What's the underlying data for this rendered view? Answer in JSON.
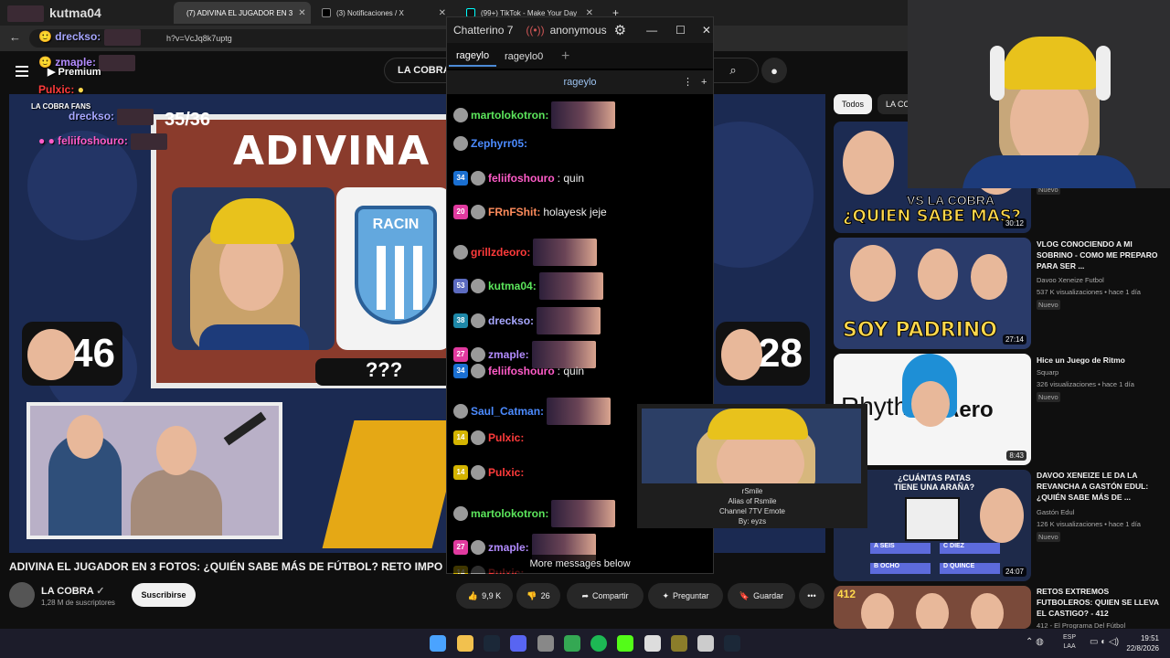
{
  "browser": {
    "tabs": [
      {
        "label": "(7) ADIVINA EL JUGADOR EN 3",
        "active": true
      },
      {
        "label": "(3) Notificaciones / X",
        "active": false
      },
      {
        "label": "(99+) TikTok - Make Your Day",
        "active": false
      }
    ],
    "first_tab_name": "kutma04",
    "url": "h?v=VcJq8k7uptg"
  },
  "youtube": {
    "search_text": "LA COBRA",
    "video": {
      "counter": "35/36",
      "thumbnail_title": "ADIVINA EL J",
      "logo_text": "RACIN",
      "left_score": "46",
      "right_score": "28",
      "question": "???"
    },
    "video_title": "ADIVINA EL JUGADOR EN 3 FOTOS: ¿QUIÉN SABE MÁS DE FÚTBOL? RETO IMPO",
    "channel": {
      "name": "LA COBRA",
      "subscribers": "1,28 M de suscriptores",
      "subscribe_label": "Suscribirse"
    },
    "actions": {
      "likes": "9,9 K",
      "dislikes": "26",
      "share": "Compartir",
      "ask": "Preguntar",
      "save": "Guardar"
    },
    "chips": [
      "Todos",
      "LA CO"
    ],
    "recommendations": [
      {
        "thumb_text": "¿QUIEN SABE MAS?",
        "thumb_sub": "VS LA COBRA",
        "duration": "30:12",
        "title": "",
        "channel": "",
        "meta": "",
        "badge": "Nuevo"
      },
      {
        "thumb_text": "SOY PADRINO",
        "thumb_sub": "",
        "duration": "27:14",
        "title": "VLOG CONOCIENDO A MI SOBRINO - COMO ME PREPARO PARA SER ...",
        "channel": "Davoo Xeneize Futbol",
        "meta": "537 K visualizaciones • hace 1 día",
        "badge": "Nuevo"
      },
      {
        "thumb_text": "Aero",
        "thumb_sub": "Rhyth",
        "duration": "8:43",
        "title": "Hice un Juego de Ritmo",
        "channel": "Squarp",
        "meta": "326 visualizaciones • hace 1 día",
        "badge": "Nuevo"
      },
      {
        "thumb_text": "¿CUÁNTAS PATAS TIENE UNA ARAÑA?",
        "thumb_sub": "",
        "duration": "24:07",
        "title": "DAVOO XENEIZE LE DA LA REVANCHA A GASTÓN EDUL: ¿QUIÉN SABE MÁS DE ...",
        "channel": "Gastón Edul",
        "meta": "126 K visualizaciones • hace 1 día",
        "badge": "Nuevo",
        "options": [
          "SEIS",
          "DIEZ",
          "OCHO",
          "QUINCE"
        ],
        "option_letters": [
          "A",
          "C",
          "B",
          "D"
        ]
      },
      {
        "thumb_text": "",
        "thumb_sub": "412",
        "duration": "",
        "title": "RETOS EXTREMOS FUTBOLEROS: QUIEN SE LLEVA EL CASTIGO? - 412",
        "channel": "412 - El Programa Del Fútbol",
        "meta": "",
        "badge": ""
      }
    ]
  },
  "overlay_chat": [
    {
      "user": "dreckso:",
      "color": "#a7a7ff"
    },
    {
      "user": "zmaple:",
      "color": "#b38cff"
    },
    {
      "user": "Premium",
      "color": "#ffffff"
    },
    {
      "user": "Pulxic:",
      "color": "#ff3b3b"
    },
    {
      "user": "LA COBRA FANS",
      "color": "#ffffff"
    },
    {
      "user": "dreckso:",
      "color": "#a7a7ff"
    },
    {
      "user": "feliifoshouro:",
      "color": "#ff5cc8"
    }
  ],
  "chatterino": {
    "title": "Chatterino 7",
    "user": "anonymous",
    "tabs": [
      "rageylo",
      "rageylo0"
    ],
    "channel": "rageylo",
    "more_messages": "More messages below",
    "messages": [
      {
        "badge": "",
        "user": "martolokotron:",
        "color": "#5ce65c",
        "text": "",
        "emote": true
      },
      {
        "badge": "",
        "user": "Zephyrr05:",
        "color": "#4c8bff",
        "text": "",
        "emote": false
      },
      {
        "badge": "34",
        "user": "feliifoshouro",
        "color": "#ff5cc8",
        "text": ": quin",
        "emote": false
      },
      {
        "badge": "20",
        "user": "FRnFShit:",
        "color": "#ff8c5c",
        "text": "holayesk jeje",
        "emote": false
      },
      {
        "badge": "",
        "user": "grillzdeoro:",
        "color": "#ff3b3b",
        "text": "",
        "emote": true
      },
      {
        "badge": "53",
        "user": "kutma04:",
        "color": "#5ce65c",
        "text": "",
        "emote": true
      },
      {
        "badge": "38",
        "user": "dreckso:",
        "color": "#a7a7ff",
        "text": "",
        "emote": true
      },
      {
        "badge": "27",
        "user": "zmaple:",
        "color": "#b38cff",
        "text": "",
        "emote": true
      },
      {
        "badge": "34",
        "user": "feliifoshouro",
        "color": "#ff5cc8",
        "text": ": quin",
        "emote": false
      },
      {
        "badge": "",
        "user": "Saul_Catman:",
        "color": "#4c8bff",
        "text": "",
        "emote": true
      },
      {
        "badge": "14",
        "user": "Pulxic:",
        "color": "#ff3b3b",
        "text": "",
        "emote": false
      },
      {
        "badge": "14",
        "user": "Pulxic:",
        "color": "#ff3b3b",
        "text": "",
        "emote": false
      },
      {
        "badge": "",
        "user": "martolokotron:",
        "color": "#5ce65c",
        "text": "",
        "emote": true
      },
      {
        "badge": "27",
        "user": "zmaple:",
        "color": "#b38cff",
        "text": "",
        "emote": true
      },
      {
        "badge": "14",
        "user": "Pulxic:",
        "color": "#ff3b3b",
        "text": "",
        "emote": false
      }
    ]
  },
  "emote_tooltip": {
    "name": "rSmile",
    "alias": "Alias of Rsmile",
    "type": "Channel 7TV Emote",
    "author": "By: eyzs"
  },
  "taskbar": {
    "lang": "ESP",
    "layout": "LAA",
    "time": "19:51",
    "date": "22/8/2026"
  }
}
